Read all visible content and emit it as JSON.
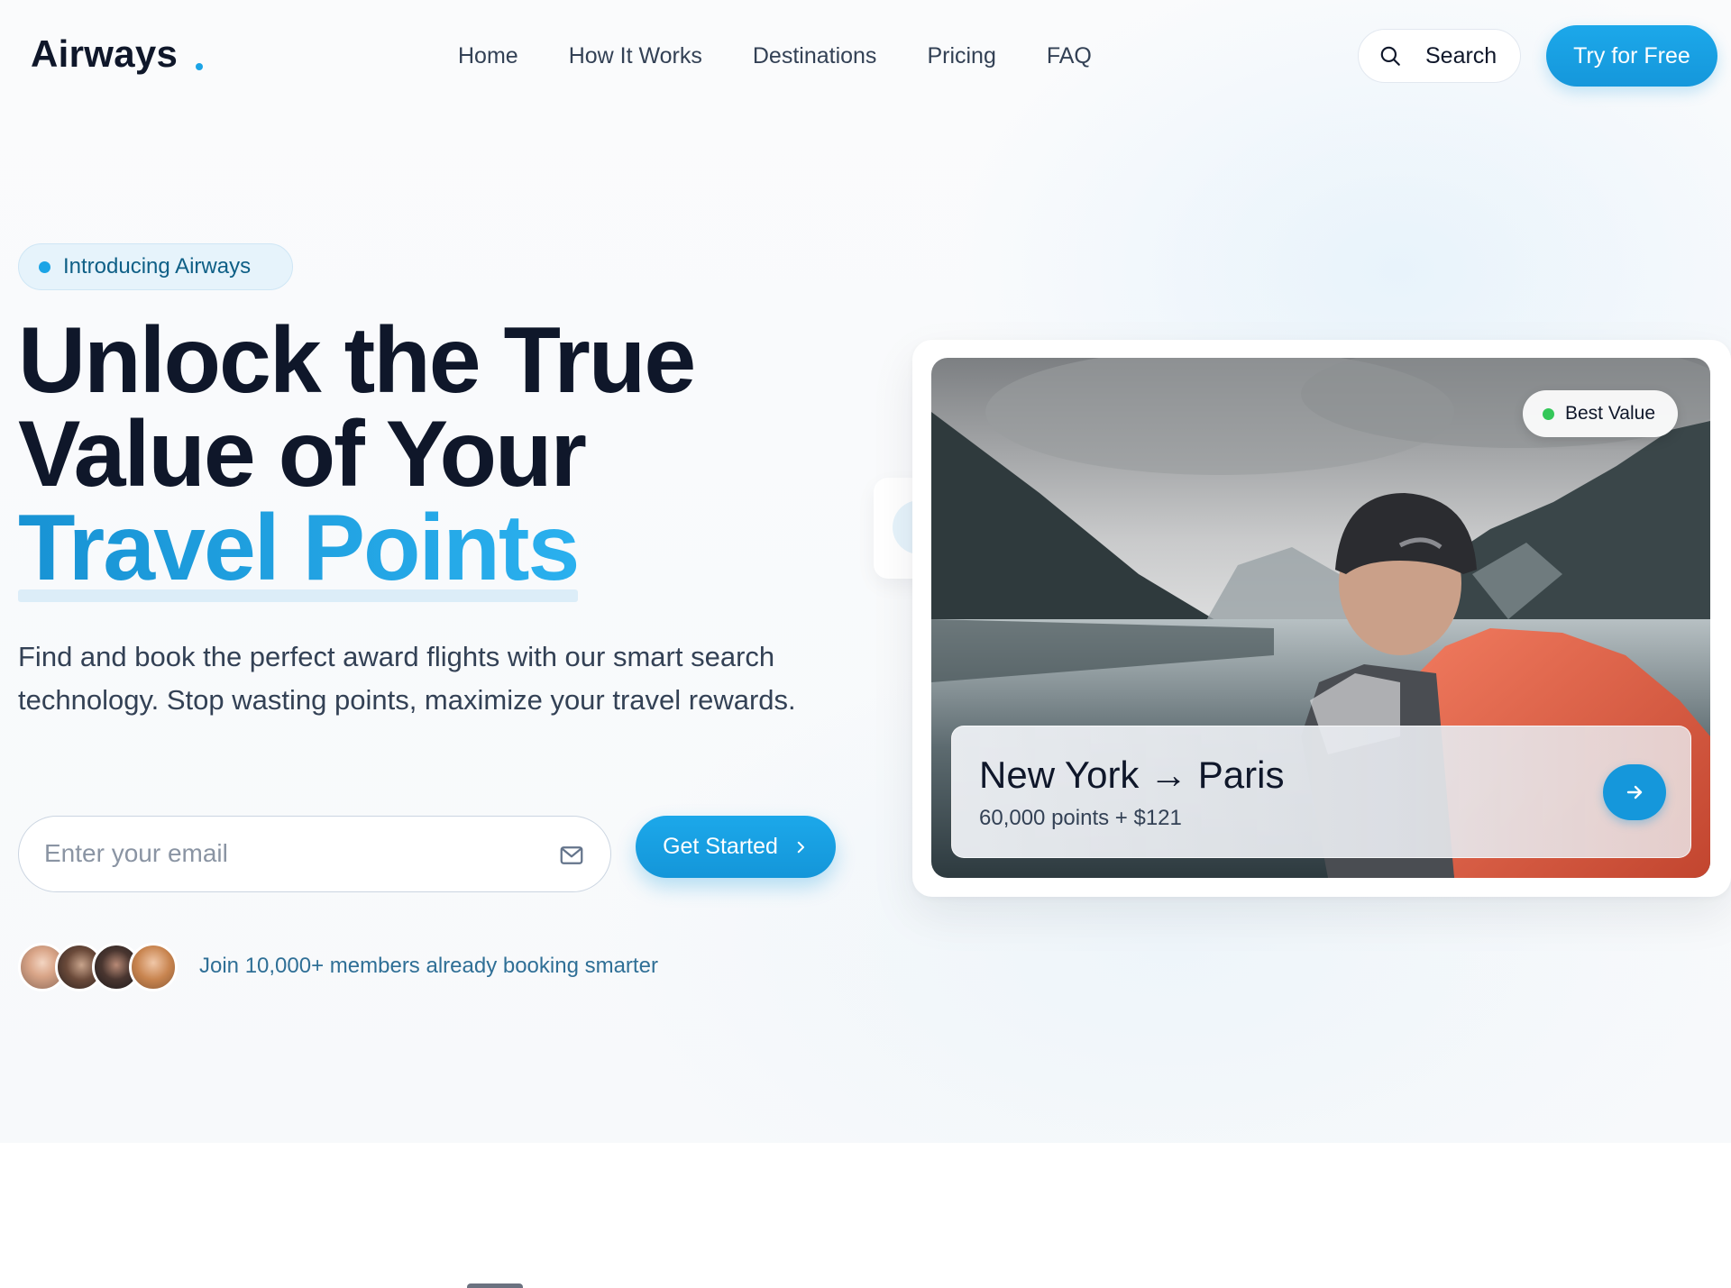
{
  "nav": {
    "logo": "Airways",
    "links": [
      "Home",
      "How It Works",
      "Destinations",
      "Pricing",
      "FAQ"
    ],
    "search_label": "Search",
    "cta_label": "Try for Free"
  },
  "hero": {
    "badge": "Introducing Airways",
    "headline_line1": "Unlock the True",
    "headline_line2": "Value of Your",
    "headline_accent": "Travel Points",
    "subtext": "Find and book the perfect award flights with our smart search technology. Stop wasting points, maximize your travel rewards.",
    "email_placeholder": "Enter your email",
    "email_value": "",
    "get_started_label": "Get Started",
    "members_text": "Join 10,000+ members already booking smarter"
  },
  "card": {
    "badge": "Best Value",
    "route": "New York → Paris",
    "price": "60,000 points + $121"
  },
  "colors": {
    "accent": "#1ba4e6",
    "text": "#0f172a",
    "badge_bg": "#e6f3fb",
    "best_value_dot": "#34c759"
  },
  "icons": [
    "search-icon",
    "mail-icon",
    "chevron-right-icon",
    "arrow-right-icon"
  ]
}
